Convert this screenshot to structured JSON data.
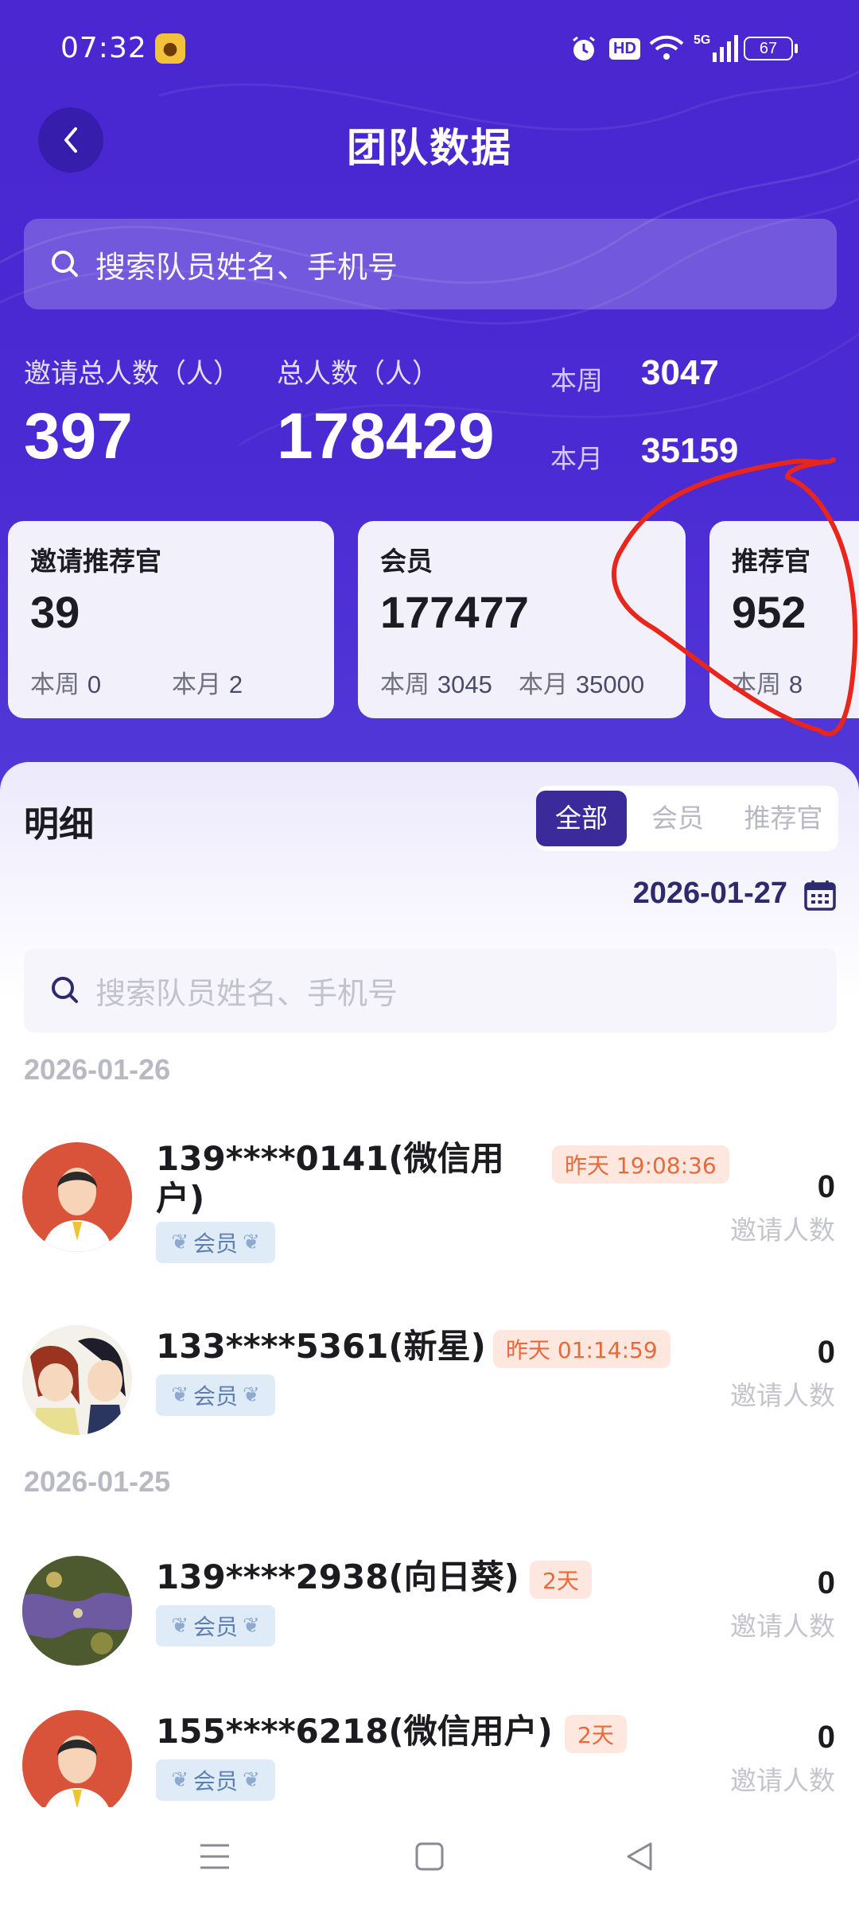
{
  "status_bar": {
    "time": "07:32",
    "battery": "67",
    "network": "5G",
    "hd": "HD"
  },
  "header": {
    "title": "团队数据"
  },
  "search_top": {
    "placeholder": "搜索队员姓名、手机号"
  },
  "summary": {
    "invite_total_label": "邀请总人数（人）",
    "invite_total_value": "397",
    "total_label": "总人数（人）",
    "total_value": "178429",
    "week_label": "本周",
    "week_value": "3047",
    "month_label": "本月",
    "month_value": "35159"
  },
  "cards": [
    {
      "title": "邀请推荐官",
      "value": "39",
      "week_label": "本周",
      "week_value": "0",
      "month_label": "本月",
      "month_value": "2"
    },
    {
      "title": "会员",
      "value": "177477",
      "week_label": "本周",
      "week_value": "3045",
      "month_label": "本月",
      "month_value": "35000"
    },
    {
      "title": "推荐官",
      "value": "952",
      "week_label": "本周",
      "week_value": "8"
    }
  ],
  "detail": {
    "title": "明细",
    "tabs": [
      "全部",
      "会员",
      "推荐官"
    ],
    "active_tab": "全部",
    "date": "2026-01-27",
    "search_placeholder": "搜索队员姓名、手机号"
  },
  "groups": [
    {
      "date": "2026-01-26",
      "items": [
        {
          "name_line1": "139****0141(微信用",
          "name_line2": "户)",
          "time": "昨天 19:08:36",
          "tag": "会员",
          "count": "0",
          "count_label": "邀请人数"
        },
        {
          "name_line1": "133****5361(新星)",
          "time": "昨天 01:14:59",
          "tag": "会员",
          "count": "0",
          "count_label": "邀请人数"
        }
      ]
    },
    {
      "date": "2026-01-25",
      "items": [
        {
          "name_line1": "139****2938(向日葵)",
          "time": "2天",
          "tag": "会员",
          "count": "0",
          "count_label": "邀请人数"
        },
        {
          "name_line1": "155****6218(微信用户)",
          "time": "2天",
          "tag": "会员",
          "count": "0",
          "count_label": "邀请人数"
        }
      ]
    }
  ],
  "colors": {
    "header_bg": "#4a27d0",
    "tab_active": "#3a2a9a",
    "badge_text": "#e86a3a",
    "badge_bg": "#fde7df",
    "annotation": "#e8261c"
  }
}
